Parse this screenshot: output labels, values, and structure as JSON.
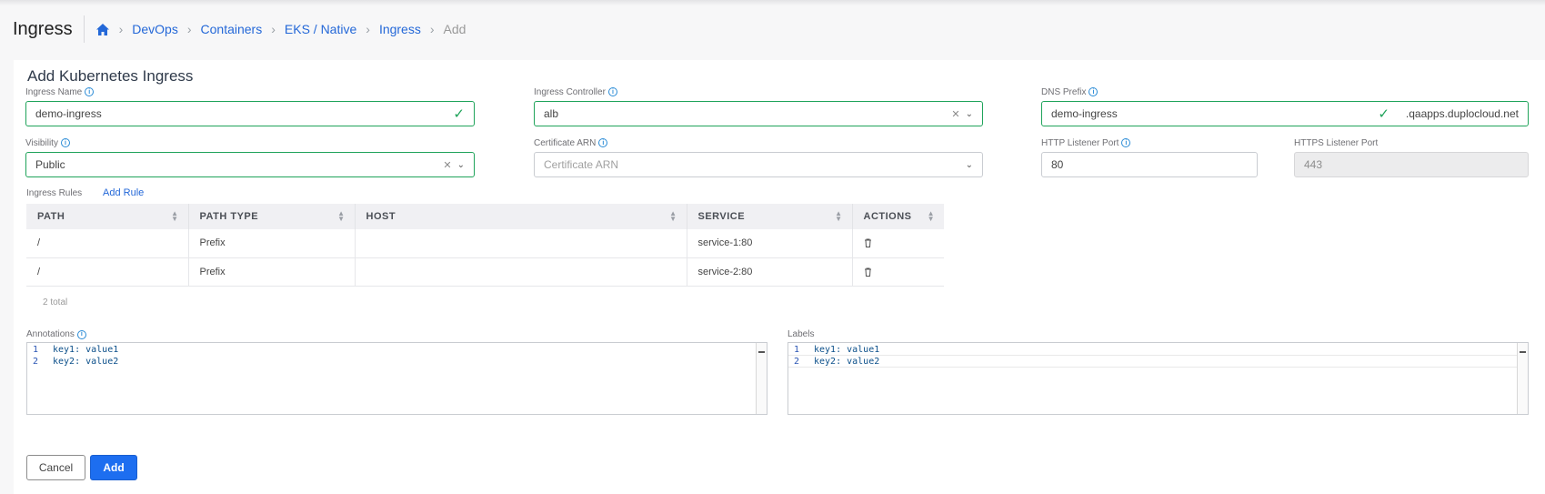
{
  "header": {
    "title": "Ingress",
    "breadcrumbs": [
      "DevOps",
      "Containers",
      "EKS / Native",
      "Ingress"
    ],
    "current": "Add"
  },
  "form": {
    "title": "Add Kubernetes Ingress",
    "ingress_name": {
      "label": "Ingress Name",
      "value": "demo-ingress"
    },
    "ingress_controller": {
      "label": "Ingress Controller",
      "value": "alb"
    },
    "dns_prefix": {
      "label": "DNS Prefix",
      "value": "demo-ingress",
      "suffix": ".qaapps.duplocloud.net"
    },
    "visibility": {
      "label": "Visibility",
      "value": "Public"
    },
    "certificate_arn": {
      "label": "Certificate ARN",
      "placeholder": "Certificate ARN"
    },
    "http_port": {
      "label": "HTTP Listener Port",
      "value": "80"
    },
    "https_port": {
      "label": "HTTPS Listener Port",
      "value": "443"
    }
  },
  "rules": {
    "label": "Ingress Rules",
    "add_label": "Add Rule",
    "columns": [
      "PATH",
      "PATH TYPE",
      "HOST",
      "SERVICE",
      "ACTIONS"
    ],
    "rows": [
      {
        "path": "/",
        "path_type": "Prefix",
        "host": "",
        "service": "service-1:80"
      },
      {
        "path": "/",
        "path_type": "Prefix",
        "host": "",
        "service": "service-2:80"
      }
    ],
    "total": "2 total"
  },
  "annotations": {
    "label": "Annotations",
    "lines": [
      {
        "n": "1",
        "text": "key1: value1"
      },
      {
        "n": "2",
        "text": "key2: value2"
      }
    ]
  },
  "labels": {
    "label": "Labels",
    "lines": [
      {
        "n": "1",
        "text": "key1: value1"
      },
      {
        "n": "2",
        "text": "key2: value2"
      }
    ]
  },
  "buttons": {
    "cancel": "Cancel",
    "add": "Add"
  },
  "colors": {
    "accent": "#2468d8",
    "valid": "#1fa35a",
    "primary_button": "#1d6ef0"
  }
}
